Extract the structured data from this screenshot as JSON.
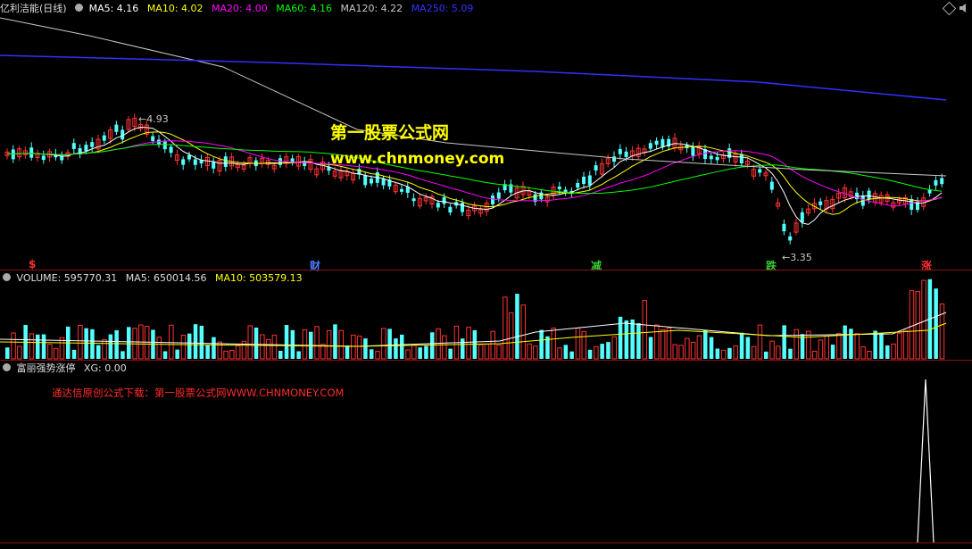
{
  "main_panel": {
    "stock_name": "亿利洁能(日线)",
    "ma": [
      {
        "label": "MA5: 4.16",
        "color": "#ffffff"
      },
      {
        "label": "MA10: 4.02",
        "color": "#ffff00"
      },
      {
        "label": "MA20: 4.00",
        "color": "#ff00ff"
      },
      {
        "label": "MA60: 4.16",
        "color": "#00ff00"
      },
      {
        "label": "MA120: 4.22",
        "color": "#c8c8c8"
      },
      {
        "label": "MA250: 5.09",
        "color": "#3333ff"
      }
    ],
    "high_label": "4.93",
    "low_label": "3.35",
    "watermark_title": "第一股票公式网",
    "watermark_url": "www.chnmoney.com",
    "event_markers": [
      {
        "text": "$",
        "color": "#ff3030"
      },
      {
        "text": "财",
        "color": "#4b7bff"
      },
      {
        "text": "减",
        "color": "#33cc33"
      },
      {
        "text": "跌",
        "color": "#33cc33"
      },
      {
        "text": "涨",
        "color": "#ff3030"
      }
    ]
  },
  "volume_panel": {
    "title": "VOLUME: 595770.31",
    "ma5": "MA5: 650014.56",
    "ma10": "MA10: 503579.13"
  },
  "indicator_panel": {
    "title": "富丽强势涨停",
    "xg": "XG: 0.00",
    "ad_text": "通达信原创公式下载：第一股票公式网WWW.CHNMONEY.COM"
  },
  "colors": {
    "up": "#ff3232",
    "down": "#54ffff",
    "separator": "#8a1414"
  },
  "icons": [
    "circle-toggle-icon",
    "diamond-icon",
    "sound-icon"
  ],
  "chart_data": {
    "type": "candlestick",
    "y_range_visible": [
      3.35,
      4.93
    ],
    "indicator_signal": {
      "name": "XG",
      "value": 0.0
    }
  }
}
